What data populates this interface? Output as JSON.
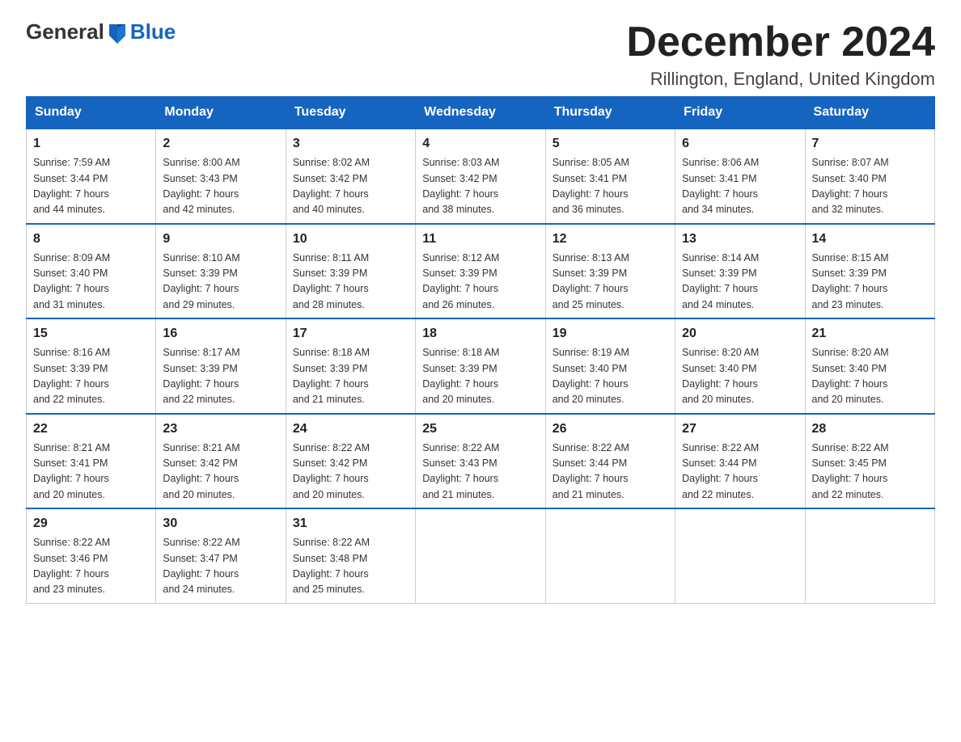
{
  "logo": {
    "general": "General",
    "blue": "Blue"
  },
  "title": "December 2024",
  "subtitle": "Rillington, England, United Kingdom",
  "days_of_week": [
    "Sunday",
    "Monday",
    "Tuesday",
    "Wednesday",
    "Thursday",
    "Friday",
    "Saturday"
  ],
  "weeks": [
    [
      {
        "day": "1",
        "sunrise": "7:59 AM",
        "sunset": "3:44 PM",
        "daylight": "7 hours and 44 minutes."
      },
      {
        "day": "2",
        "sunrise": "8:00 AM",
        "sunset": "3:43 PM",
        "daylight": "7 hours and 42 minutes."
      },
      {
        "day": "3",
        "sunrise": "8:02 AM",
        "sunset": "3:42 PM",
        "daylight": "7 hours and 40 minutes."
      },
      {
        "day": "4",
        "sunrise": "8:03 AM",
        "sunset": "3:42 PM",
        "daylight": "7 hours and 38 minutes."
      },
      {
        "day": "5",
        "sunrise": "8:05 AM",
        "sunset": "3:41 PM",
        "daylight": "7 hours and 36 minutes."
      },
      {
        "day": "6",
        "sunrise": "8:06 AM",
        "sunset": "3:41 PM",
        "daylight": "7 hours and 34 minutes."
      },
      {
        "day": "7",
        "sunrise": "8:07 AM",
        "sunset": "3:40 PM",
        "daylight": "7 hours and 32 minutes."
      }
    ],
    [
      {
        "day": "8",
        "sunrise": "8:09 AM",
        "sunset": "3:40 PM",
        "daylight": "7 hours and 31 minutes."
      },
      {
        "day": "9",
        "sunrise": "8:10 AM",
        "sunset": "3:39 PM",
        "daylight": "7 hours and 29 minutes."
      },
      {
        "day": "10",
        "sunrise": "8:11 AM",
        "sunset": "3:39 PM",
        "daylight": "7 hours and 28 minutes."
      },
      {
        "day": "11",
        "sunrise": "8:12 AM",
        "sunset": "3:39 PM",
        "daylight": "7 hours and 26 minutes."
      },
      {
        "day": "12",
        "sunrise": "8:13 AM",
        "sunset": "3:39 PM",
        "daylight": "7 hours and 25 minutes."
      },
      {
        "day": "13",
        "sunrise": "8:14 AM",
        "sunset": "3:39 PM",
        "daylight": "7 hours and 24 minutes."
      },
      {
        "day": "14",
        "sunrise": "8:15 AM",
        "sunset": "3:39 PM",
        "daylight": "7 hours and 23 minutes."
      }
    ],
    [
      {
        "day": "15",
        "sunrise": "8:16 AM",
        "sunset": "3:39 PM",
        "daylight": "7 hours and 22 minutes."
      },
      {
        "day": "16",
        "sunrise": "8:17 AM",
        "sunset": "3:39 PM",
        "daylight": "7 hours and 22 minutes."
      },
      {
        "day": "17",
        "sunrise": "8:18 AM",
        "sunset": "3:39 PM",
        "daylight": "7 hours and 21 minutes."
      },
      {
        "day": "18",
        "sunrise": "8:18 AM",
        "sunset": "3:39 PM",
        "daylight": "7 hours and 20 minutes."
      },
      {
        "day": "19",
        "sunrise": "8:19 AM",
        "sunset": "3:40 PM",
        "daylight": "7 hours and 20 minutes."
      },
      {
        "day": "20",
        "sunrise": "8:20 AM",
        "sunset": "3:40 PM",
        "daylight": "7 hours and 20 minutes."
      },
      {
        "day": "21",
        "sunrise": "8:20 AM",
        "sunset": "3:40 PM",
        "daylight": "7 hours and 20 minutes."
      }
    ],
    [
      {
        "day": "22",
        "sunrise": "8:21 AM",
        "sunset": "3:41 PM",
        "daylight": "7 hours and 20 minutes."
      },
      {
        "day": "23",
        "sunrise": "8:21 AM",
        "sunset": "3:42 PM",
        "daylight": "7 hours and 20 minutes."
      },
      {
        "day": "24",
        "sunrise": "8:22 AM",
        "sunset": "3:42 PM",
        "daylight": "7 hours and 20 minutes."
      },
      {
        "day": "25",
        "sunrise": "8:22 AM",
        "sunset": "3:43 PM",
        "daylight": "7 hours and 21 minutes."
      },
      {
        "day": "26",
        "sunrise": "8:22 AM",
        "sunset": "3:44 PM",
        "daylight": "7 hours and 21 minutes."
      },
      {
        "day": "27",
        "sunrise": "8:22 AM",
        "sunset": "3:44 PM",
        "daylight": "7 hours and 22 minutes."
      },
      {
        "day": "28",
        "sunrise": "8:22 AM",
        "sunset": "3:45 PM",
        "daylight": "7 hours and 22 minutes."
      }
    ],
    [
      {
        "day": "29",
        "sunrise": "8:22 AM",
        "sunset": "3:46 PM",
        "daylight": "7 hours and 23 minutes."
      },
      {
        "day": "30",
        "sunrise": "8:22 AM",
        "sunset": "3:47 PM",
        "daylight": "7 hours and 24 minutes."
      },
      {
        "day": "31",
        "sunrise": "8:22 AM",
        "sunset": "3:48 PM",
        "daylight": "7 hours and 25 minutes."
      },
      null,
      null,
      null,
      null
    ]
  ],
  "labels": {
    "sunrise": "Sunrise:",
    "sunset": "Sunset:",
    "daylight": "Daylight:"
  }
}
